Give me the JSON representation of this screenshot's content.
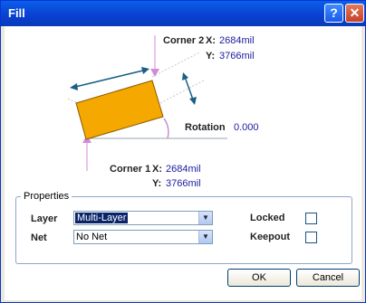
{
  "window": {
    "title": "Fill"
  },
  "diagram": {
    "corner2": {
      "label": "Corner 2",
      "x_label": "X:",
      "x_value": "2684mil",
      "y_label": "Y:",
      "y_value": "3766mil"
    },
    "rotation": {
      "label": "Rotation",
      "value": "0.000"
    },
    "corner1": {
      "label": "Corner 1",
      "x_label": "X:",
      "x_value": "2684mil",
      "y_label": "Y:",
      "y_value": "3766mil"
    },
    "fill_color": "#f5a800",
    "arrow_color": "#1a5f86"
  },
  "properties": {
    "group_label": "Properties",
    "layer_label": "Layer",
    "layer_value": "Multi-Layer",
    "net_label": "Net",
    "net_value": "No Net",
    "locked_label": "Locked",
    "locked_checked": false,
    "keepout_label": "Keepout",
    "keepout_checked": false
  },
  "buttons": {
    "ok": "OK",
    "cancel": "Cancel"
  }
}
